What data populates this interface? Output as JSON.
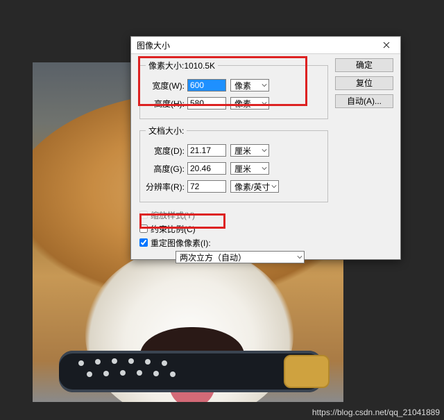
{
  "dialog": {
    "title": "图像大小",
    "pixel_group": {
      "legend": "像素大小:1010.5K",
      "width_label": "宽度(W):",
      "width_value": "600",
      "width_unit": "像素",
      "height_label": "高度(H):",
      "height_value": "580",
      "height_unit": "像素"
    },
    "doc_group": {
      "legend": "文档大小:",
      "width_label": "宽度(D):",
      "width_value": "21.17",
      "width_unit": "厘米",
      "height_label": "高度(G):",
      "height_value": "20.46",
      "height_unit": "厘米",
      "res_label": "分辨率(R):",
      "res_value": "72",
      "res_unit": "像素/英寸"
    },
    "scale_styles_label": "缩放样式(Y)",
    "constrain_label": "约束比例(C)",
    "resample_label": "重定图像像素(I):",
    "interp_value": "两次立方（自动）",
    "buttons": {
      "ok": "确定",
      "reset": "复位",
      "auto": "自动(A)..."
    }
  },
  "watermark": "https://blog.csdn.net/qq_21041889"
}
